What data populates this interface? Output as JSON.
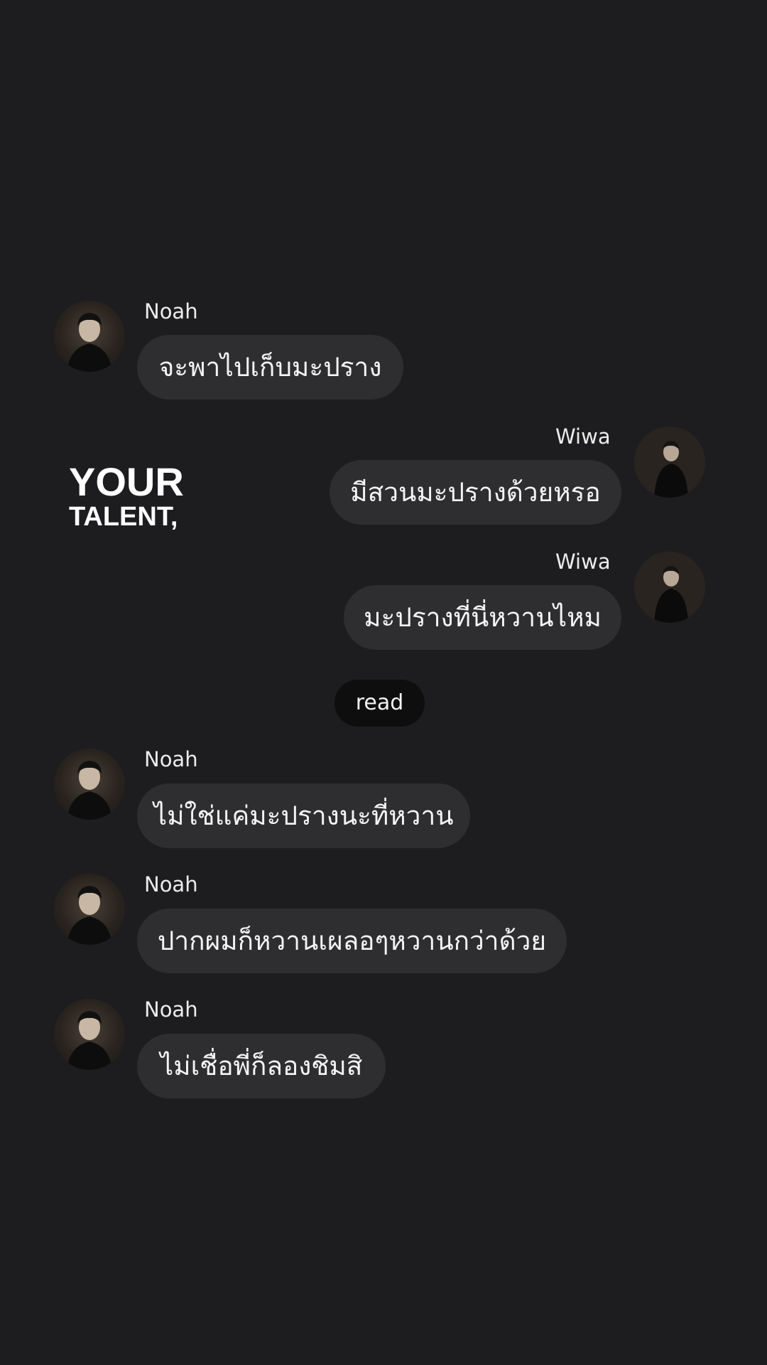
{
  "overlay": {
    "line1": "YOUR",
    "line2": "TALENT,"
  },
  "messages": [
    {
      "sender": "Noah",
      "text": "จะพาไปเก็บมะปราง"
    },
    {
      "sender": "Wiwa",
      "text": "มีสวนมะปรางด้วยหรอ"
    },
    {
      "sender": "Wiwa",
      "text": "มะปรางที่นี่หวานไหม"
    },
    {
      "sender": "Noah",
      "text": "ไม่ใช่แค่มะปรางนะที่หวาน"
    },
    {
      "sender": "Noah",
      "text": "ปากผมก็หวานเผลอๆหวานกว่าด้วย"
    },
    {
      "sender": "Noah",
      "text": "ไม่เชื่อพี่ก็ลองชิมสิ"
    }
  ],
  "status": {
    "read_label": "read"
  },
  "colors": {
    "background": "#1d1d1f",
    "bubble": "#2e2e31",
    "read_pill": "#0e0e0f",
    "text": "#f2f2f2"
  }
}
